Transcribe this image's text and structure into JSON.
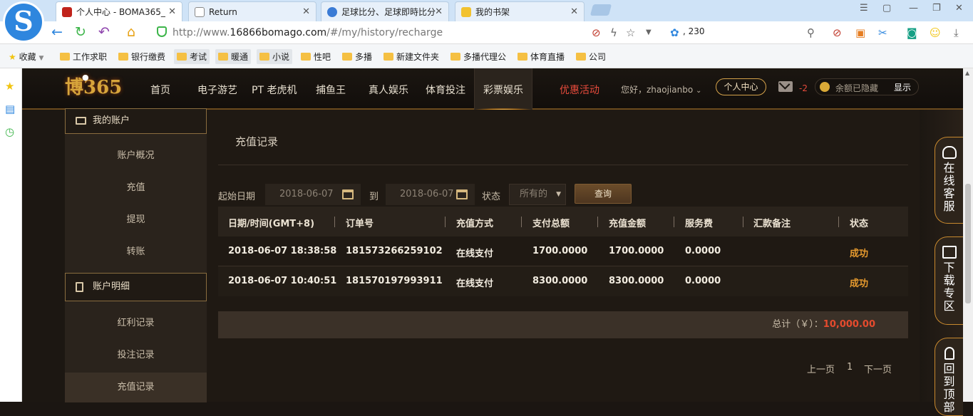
{
  "browser": {
    "tabs": [
      {
        "title": "个人中心 - BOMA365_",
        "active": true
      },
      {
        "title": "Return",
        "active": false
      },
      {
        "title": "足球比分、足球即時比分",
        "active": false
      },
      {
        "title": "我的书架",
        "active": false
      }
    ],
    "url_prefix": "http://www.",
    "url_domain": "16866bomago.com",
    "url_path": "/#/my/history/recharge",
    "addr_extra": "230"
  },
  "bookmarks": [
    "收藏",
    "工作求职",
    "银行缴费",
    "考试",
    "暖通",
    "小说",
    "性吧",
    "多播",
    "新建文件夹",
    "多播代理公",
    "体育直播",
    "公司"
  ],
  "site": {
    "logo_main": "博365",
    "nav": [
      "首页",
      "电子游艺",
      "PT 老虎机",
      "捕鱼王",
      "真人娱乐",
      "体育投注",
      "彩票娱乐",
      "优惠活动"
    ],
    "greeting": "您好，zhaojianbo",
    "center_btn": "个人中心",
    "mail_count": "-2",
    "balance_hidden": "余额已隐藏",
    "balance_show": "显示",
    "accent": "#d4a24a",
    "promo_color": "#e84b3c"
  },
  "sidebar": {
    "group1": "我的账户",
    "items1": [
      "账户概况",
      "充值",
      "提现",
      "转账"
    ],
    "group2": "账户明细",
    "items2": [
      "红利记录",
      "投注记录",
      "充值记录"
    ]
  },
  "content": {
    "title": "充值记录",
    "filter": {
      "start_label": "起始日期",
      "start_date": "2018-06-07",
      "to_label": "到",
      "end_date": "2018-06-07",
      "status_label": "状态",
      "status_value": "所有的",
      "query_btn": "查询"
    },
    "columns": [
      "日期/时间(GMT+8)",
      "订单号",
      "充值方式",
      "支付总额",
      "充值金额",
      "服务费",
      "汇款备注",
      "状态"
    ],
    "rows": [
      [
        "2018-06-07 18:38:58",
        "181573266259102",
        "在线支付",
        "1700.0000",
        "1700.0000",
        "0.0000",
        "",
        "成功"
      ],
      [
        "2018-06-07 10:40:51",
        "181570197993911",
        "在线支付",
        "8300.0000",
        "8300.0000",
        "0.0000",
        "",
        "成功"
      ]
    ],
    "total_label": "总计（￥）：",
    "total_value": "10,000.00",
    "pager": {
      "prev": "上一页",
      "page": "1",
      "next": "下一页"
    }
  },
  "float_tools": [
    {
      "label": "在线客服"
    },
    {
      "label": "下载专区"
    },
    {
      "label": "回到顶部"
    }
  ]
}
